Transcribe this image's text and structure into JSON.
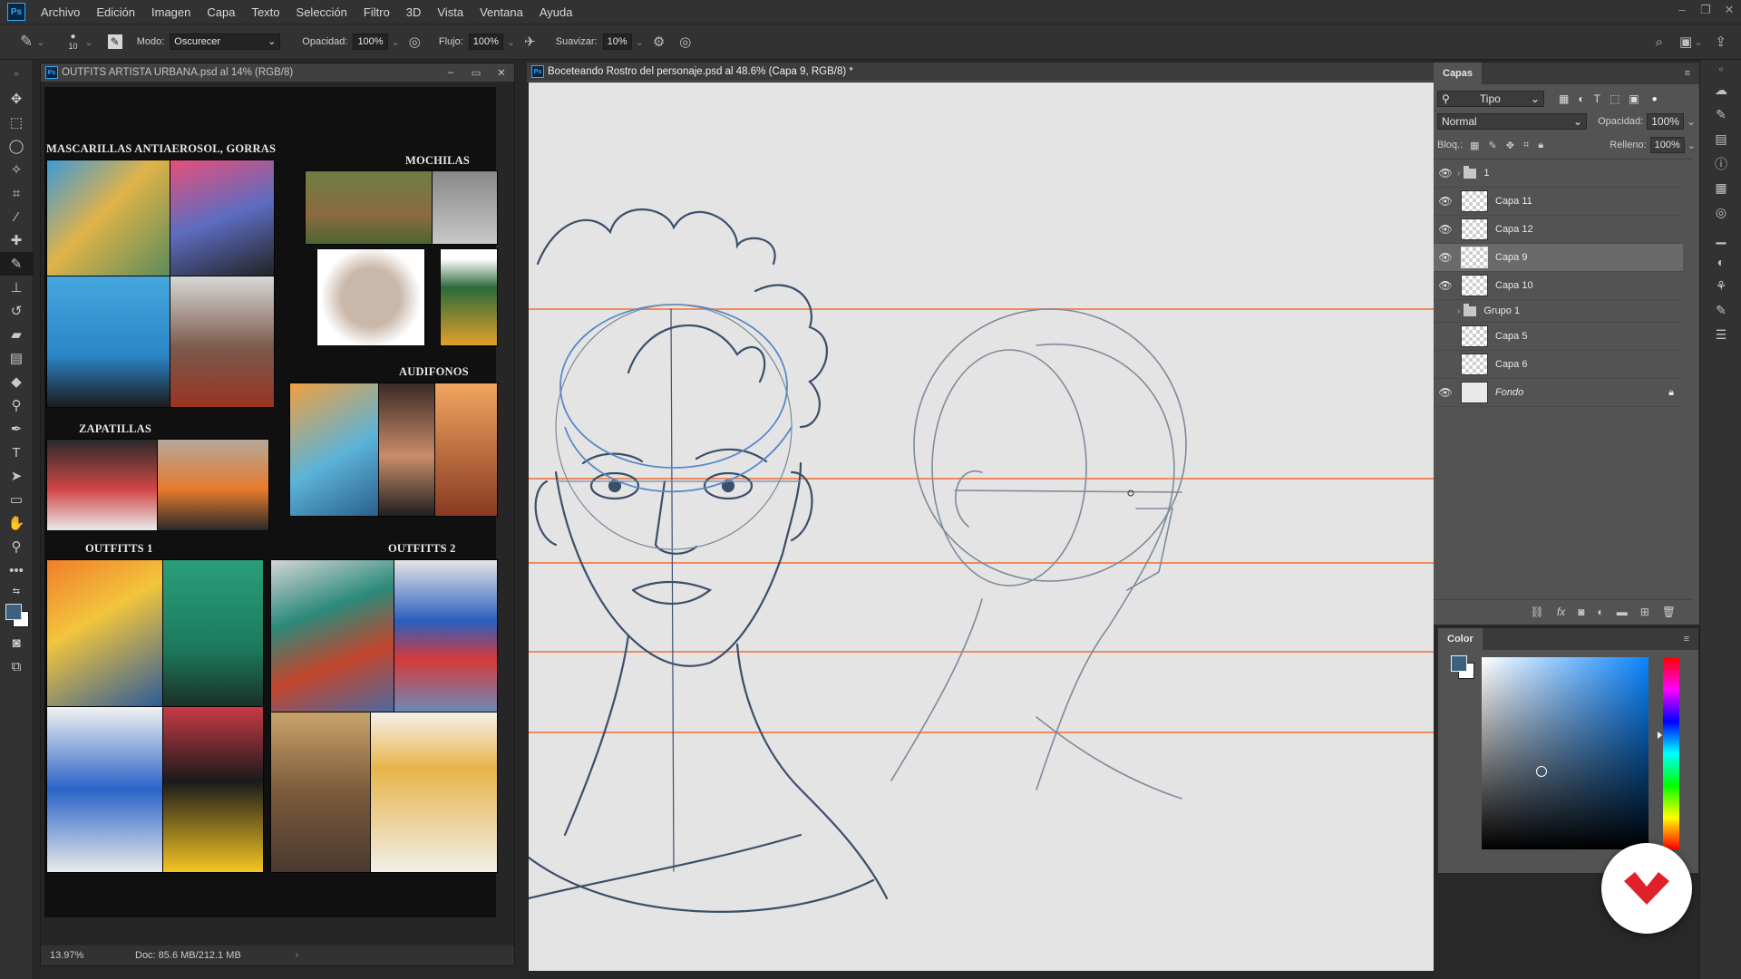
{
  "app": {
    "name": "Ps"
  },
  "menu": [
    "Archivo",
    "Edición",
    "Imagen",
    "Capa",
    "Texto",
    "Selección",
    "Filtro",
    "3D",
    "Vista",
    "Ventana",
    "Ayuda"
  ],
  "options": {
    "brush_size": "10",
    "mode_label": "Modo:",
    "mode_value": "Oscurecer",
    "opacity_label": "Opacidad:",
    "opacity_value": "100%",
    "flow_label": "Flujo:",
    "flow_value": "100%",
    "smooth_label": "Suavizar:",
    "smooth_value": "10%"
  },
  "doc1": {
    "title": "OUTFITS ARTISTA URBANA.psd al 14% (RGB/8)",
    "zoom": "13.97%",
    "docinfo": "Doc: 85.6 MB/212.1 MB",
    "labels": {
      "masks": "MASCARILLAS  ANTIAEROSOL, GORRAS",
      "backpacks": "MOCHILAS",
      "headphones": "AUDIFONOS",
      "sneakers": "ZAPATILLAS",
      "outfits1": "OUTFITTS 1",
      "outfits2": "OUTFITTS 2"
    }
  },
  "doc2": {
    "title": "Boceteando Rostro del personaje.psd al 48.6% (Capa 9, RGB/8) *"
  },
  "layers_panel": {
    "tab": "Capas",
    "filter": "Tipo",
    "blend": "Normal",
    "opacity_label": "Opacidad:",
    "opacity_value": "100%",
    "lock_label": "Bloq.:",
    "fill_label": "Relleno:",
    "fill_value": "100%",
    "layers": [
      {
        "name": "1",
        "kind": "group",
        "visible": true
      },
      {
        "name": "Capa 11",
        "kind": "layer",
        "visible": true
      },
      {
        "name": "Capa 12",
        "kind": "layer",
        "visible": true
      },
      {
        "name": "Capa 9",
        "kind": "layer",
        "visible": true,
        "selected": true
      },
      {
        "name": "Capa 10",
        "kind": "layer",
        "visible": true
      },
      {
        "name": "Grupo 1",
        "kind": "group",
        "visible": false
      },
      {
        "name": "Capa 5",
        "kind": "layer",
        "visible": false
      },
      {
        "name": "Capa 6",
        "kind": "layer",
        "visible": false
      },
      {
        "name": "Fondo",
        "kind": "background",
        "visible": true,
        "locked": true
      }
    ]
  },
  "color_panel": {
    "tab": "Color",
    "foreground": "#3d6080",
    "background": "#ffffff"
  },
  "colors": {
    "guide_lines": "#f08a5d",
    "sketch_stroke": "#3b4f6a",
    "sketch_blue": "#5a87c9",
    "badge_red": "#e0202a"
  }
}
